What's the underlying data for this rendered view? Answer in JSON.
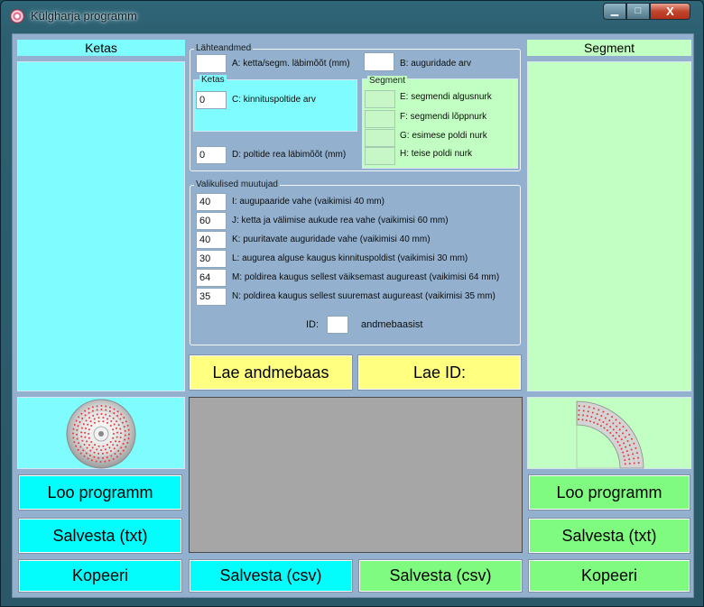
{
  "window": {
    "title": "Külgharja programm",
    "min_glyph": "▁",
    "max_glyph": "□",
    "close_glyph": "X"
  },
  "left": {
    "header": "Ketas",
    "btn_create": "Loo programm",
    "btn_save_txt": "Salvesta (txt)",
    "btn_copy": "Kopeeri"
  },
  "right": {
    "header": "Segment",
    "btn_create": "Loo programm",
    "btn_save_txt": "Salvesta (txt)",
    "btn_copy": "Kopeeri"
  },
  "inputs": {
    "legend": "Lähteandmed",
    "A_value": "",
    "A_label": "A: ketta/segm. läbimõõt (mm)",
    "B_value": "",
    "B_label": "B: auguridade arv",
    "ketas_legend": "Ketas",
    "C_value": "0",
    "C_label": "C: kinnituspoltide arv",
    "D_value": "0",
    "D_label": "D: poltide rea läbimõõt (mm)",
    "segment_legend": "Segment",
    "E_value": "",
    "E_label": "E: segmendi algusnurk",
    "F_value": "",
    "F_label": "F: segmendi lõppnurk",
    "G_value": "",
    "G_label": "G: esimese poldi nurk",
    "H_value": "",
    "H_label": "H: teise poldi nurk"
  },
  "optional": {
    "legend": "Valikulised muutujad",
    "rows": [
      {
        "value": "40",
        "label": "I: augupaaride vahe (vaikimisi 40 mm)"
      },
      {
        "value": "60",
        "label": "J: ketta ja välimise aukude rea vahe (vaikimisi 60 mm)"
      },
      {
        "value": "40",
        "label": "K: puuritavate auguridade vahe (vaikimisi 40 mm)"
      },
      {
        "value": "30",
        "label": "L: augurea alguse kaugus kinnituspoldist (vaikimisi 30 mm)"
      },
      {
        "value": "64",
        "label": "M: poldirea kaugus sellest väiksemast augureast (vaikimisi 64 mm)"
      },
      {
        "value": "35",
        "label": "N: poldirea kaugus sellest suuremast augureast (vaikimisi 35 mm)"
      }
    ],
    "id_label": "ID:",
    "id_value": "",
    "id_suffix": "andmebaasist"
  },
  "center": {
    "btn_load_db": "Lae andmebaas",
    "btn_load_id": "Lae ID:",
    "btn_save_csv_left": "Salvesta (csv)",
    "btn_save_csv_right": "Salvesta (csv)"
  },
  "colors": {
    "cyan_panel": "#7ffdfe",
    "green_panel": "#c2ffc2",
    "cyan_button": "#03fdfd",
    "green_button": "#7ffc7f",
    "yellow_button": "#ffff80",
    "preview_gray": "#a6a6a6",
    "client_bg": "#93b1cf"
  }
}
